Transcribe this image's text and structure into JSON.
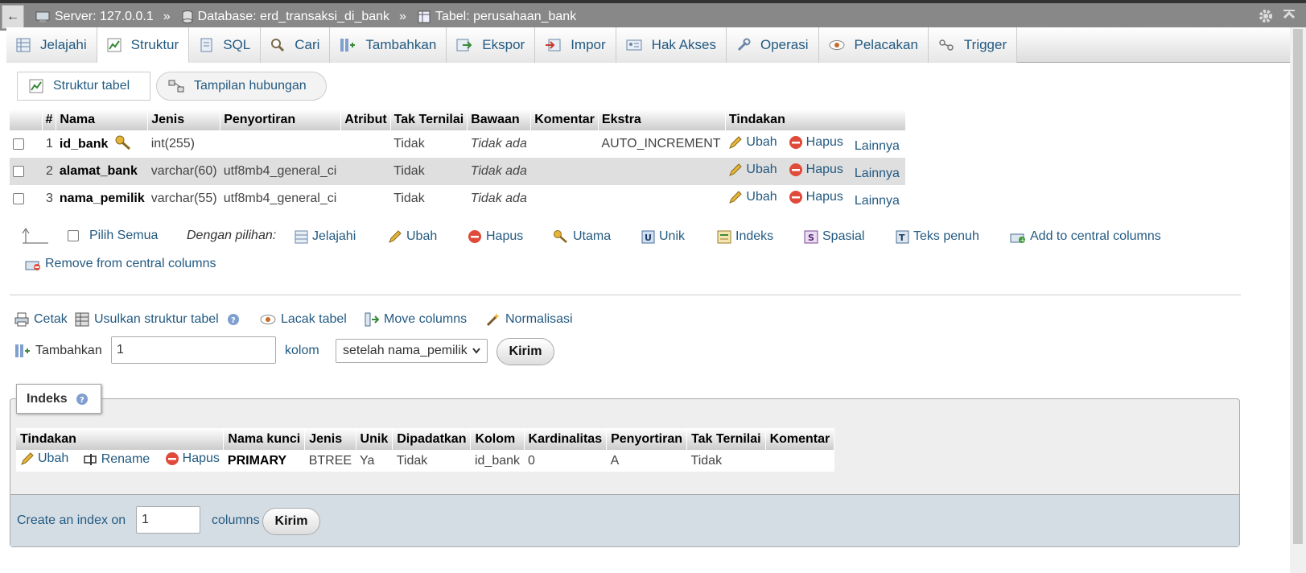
{
  "breadcrumb": {
    "back": "←",
    "server": "Server: 127.0.0.1",
    "database": "Database: erd_transaksi_di_bank",
    "table": "Tabel: perusahaan_bank",
    "separator": "»"
  },
  "tabs": [
    {
      "label": "Jelajahi",
      "icon": "browse-icon"
    },
    {
      "label": "Struktur",
      "icon": "structure-icon",
      "active": true
    },
    {
      "label": "SQL",
      "icon": "sql-icon"
    },
    {
      "label": "Cari",
      "icon": "search-icon"
    },
    {
      "label": "Tambahkan",
      "icon": "insert-icon"
    },
    {
      "label": "Ekspor",
      "icon": "export-icon"
    },
    {
      "label": "Impor",
      "icon": "import-icon"
    },
    {
      "label": "Hak Akses",
      "icon": "privileges-icon"
    },
    {
      "label": "Operasi",
      "icon": "wrench-icon"
    },
    {
      "label": "Pelacakan",
      "icon": "eye-icon"
    },
    {
      "label": "Trigger",
      "icon": "trigger-icon"
    }
  ],
  "subtabs": {
    "structure": "Struktur tabel",
    "relations": "Tampilan hubungan"
  },
  "structure": {
    "headers": [
      "#",
      "Nama",
      "Jenis",
      "Penyortiran",
      "Atribut",
      "Tak Ternilai",
      "Bawaan",
      "Komentar",
      "Ekstra",
      "Tindakan"
    ],
    "rows": [
      {
        "num": "1",
        "name": "id_bank",
        "type": "int(255)",
        "collation": "",
        "attr": "",
        "null": "Tidak",
        "default": "Tidak ada",
        "comment": "",
        "extra": "AUTO_INCREMENT",
        "primary": true
      },
      {
        "num": "2",
        "name": "alamat_bank",
        "type": "varchar(60)",
        "collation": "utf8mb4_general_ci",
        "attr": "",
        "null": "Tidak",
        "default": "Tidak ada",
        "comment": "",
        "extra": ""
      },
      {
        "num": "3",
        "name": "nama_pemilik",
        "type": "varchar(55)",
        "collation": "utf8mb4_general_ci",
        "attr": "",
        "null": "Tidak",
        "default": "Tidak ada",
        "comment": "",
        "extra": ""
      }
    ],
    "actions": {
      "edit": "Ubah",
      "drop": "Hapus",
      "more": "Lainnya"
    }
  },
  "bulk": {
    "check_all": "Pilih Semua",
    "with_selected": "Dengan pilihan:",
    "browse": "Jelajahi",
    "edit": "Ubah",
    "drop": "Hapus",
    "primary": "Utama",
    "unique": "Unik",
    "index": "Indeks",
    "spatial": "Spasial",
    "fulltext": "Teks penuh",
    "add_central": "Add to central columns",
    "remove_central": "Remove from central columns"
  },
  "toolbar": {
    "print": "Cetak",
    "propose": "Usulkan struktur tabel",
    "track": "Lacak tabel",
    "move": "Move columns",
    "normalize": "Normalisasi"
  },
  "add_column": {
    "label": "Tambahkan",
    "value": "1",
    "unit": "kolom",
    "position": "setelah nama_pemilik",
    "submit": "Kirim"
  },
  "indexes": {
    "legend": "Indeks",
    "headers": [
      "Tindakan",
      "Nama kunci",
      "Jenis",
      "Unik",
      "Dipadatkan",
      "Kolom",
      "Kardinalitas",
      "Penyortiran",
      "Tak Ternilai",
      "Komentar"
    ],
    "row": {
      "edit": "Ubah",
      "rename": "Rename",
      "drop": "Hapus",
      "key": "PRIMARY",
      "type": "BTREE",
      "unique": "Ya",
      "packed": "Tidak",
      "column": "id_bank",
      "cardinality": "0",
      "collation": "A",
      "null": "Tidak",
      "comment": ""
    },
    "create_label": "Create an index on",
    "create_value": "1",
    "create_unit": "columns",
    "create_submit": "Kirim"
  },
  "colors": {
    "link": "#235a81",
    "topbar": "#888888",
    "drop": "#e04a3a",
    "edit": "#d9a21b"
  }
}
